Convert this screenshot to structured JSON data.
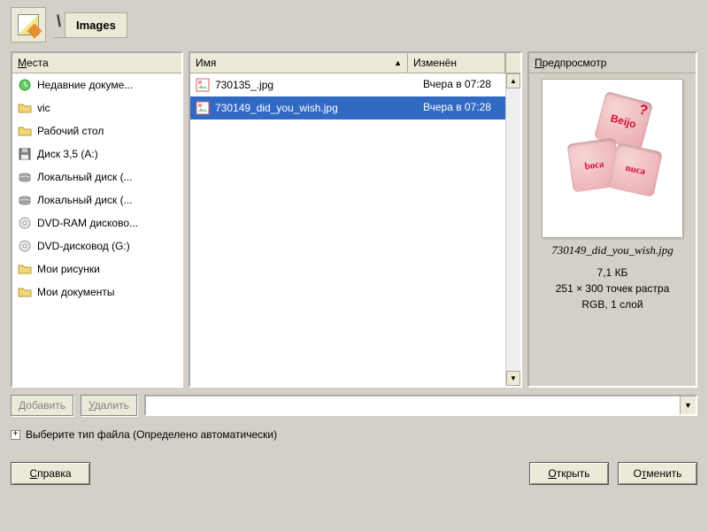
{
  "toolbar": {
    "current_folder": "Images"
  },
  "places": {
    "header": "Места",
    "items": [
      {
        "icon": "recent",
        "label": "Недавние докуме..."
      },
      {
        "icon": "folder",
        "label": "vic"
      },
      {
        "icon": "folder",
        "label": "Рабочий стол"
      },
      {
        "icon": "floppy",
        "label": "Диск 3,5 (A:)"
      },
      {
        "icon": "hdd",
        "label": "Локальный диск (..."
      },
      {
        "icon": "hdd",
        "label": "Локальный диск (..."
      },
      {
        "icon": "cd",
        "label": "DVD-RAM дисково..."
      },
      {
        "icon": "cd",
        "label": "DVD-дисковод (G:)"
      },
      {
        "icon": "folder",
        "label": "Мои рисунки"
      },
      {
        "icon": "folder",
        "label": "Мои документы"
      }
    ]
  },
  "files": {
    "col_name": "Имя",
    "col_modified": "Изменён",
    "rows": [
      {
        "icon": "img",
        "name": "730135_.jpg",
        "modified": "Вчера в 07:28",
        "selected": false
      },
      {
        "icon": "img",
        "name": "730149_did_you_wish.jpg",
        "modified": "Вчера в 07:28",
        "selected": true
      }
    ]
  },
  "preview": {
    "header": "Предпросмотр",
    "filename": "730149_did_you_wish.jpg",
    "size": "7,1 КБ",
    "dims": "251 × 300 точек растра",
    "mode": "RGB, 1 слой",
    "dice_text": {
      "a": "Beijo",
      "q": "?",
      "b": "boca",
      "c": "nuca"
    }
  },
  "buttons": {
    "add": "Добавить",
    "remove": "Удалить",
    "filetype_label": "Выберите тип файла (Определено автоматически)",
    "help": "Справка",
    "open": "Открыть",
    "cancel": "Отменить"
  }
}
